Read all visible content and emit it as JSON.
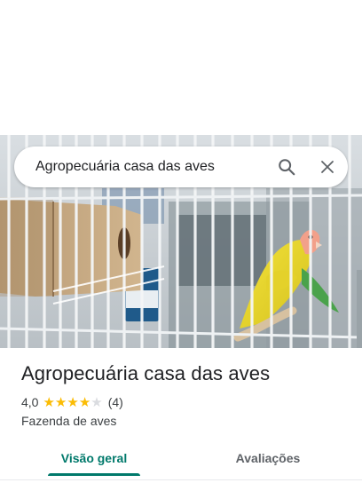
{
  "search": {
    "value": "Agropecuária casa das aves",
    "icon_search": "search-icon",
    "icon_close": "close-icon"
  },
  "place": {
    "title": "Agropecuária casa das aves",
    "rating": "4,0",
    "rating_stars": 4,
    "rating_max": 5,
    "reviews_count": "(4)",
    "category": "Fazenda de aves"
  },
  "tabs": [
    {
      "label": "Visão geral",
      "active": true
    },
    {
      "label": "Avaliações",
      "active": false
    }
  ],
  "colors": {
    "accent": "#00796b",
    "star": "#fbbc04",
    "text": "#202124"
  }
}
